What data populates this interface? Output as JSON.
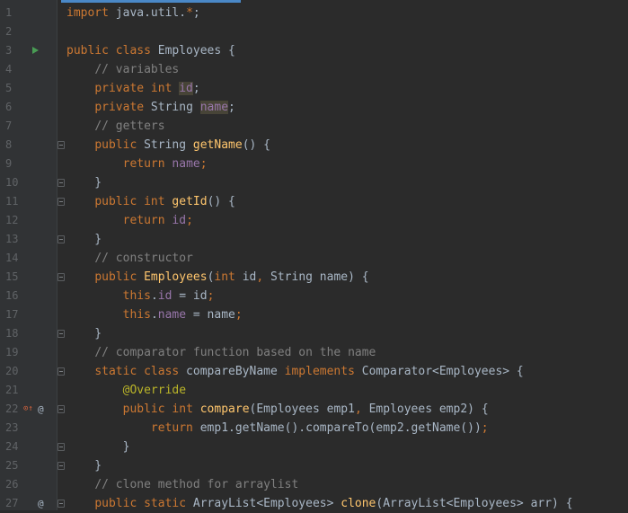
{
  "colors": {
    "background": "#2b2b2b",
    "gutter": "#313335",
    "keyword": "#cc7832",
    "comment": "#808080",
    "method": "#ffc66d",
    "field": "#9876aa",
    "annotation": "#bbb529",
    "text": "#a9b7c6",
    "line_number": "#606366",
    "run_icon": "#499c54"
  },
  "lines": [
    {
      "n": "1",
      "tokens": [
        [
          "kw",
          "import"
        ],
        [
          "t",
          " java.util."
        ],
        [
          "kw",
          "*"
        ],
        [
          "t",
          ";"
        ]
      ]
    },
    {
      "n": "2",
      "tokens": []
    },
    {
      "n": "3",
      "run": true,
      "tokens": [
        [
          "kw",
          "public class"
        ],
        [
          "t",
          " Employees {"
        ]
      ]
    },
    {
      "n": "4",
      "tokens": [
        [
          "t",
          "    "
        ],
        [
          "cm",
          "// variables"
        ]
      ]
    },
    {
      "n": "5",
      "tokens": [
        [
          "t",
          "    "
        ],
        [
          "kw",
          "private int"
        ],
        [
          "t",
          " "
        ],
        [
          "fldhl",
          "id"
        ],
        [
          "t",
          ";"
        ]
      ]
    },
    {
      "n": "6",
      "tokens": [
        [
          "t",
          "    "
        ],
        [
          "kw",
          "private"
        ],
        [
          "t",
          " String "
        ],
        [
          "fldhl",
          "name"
        ],
        [
          "t",
          ";"
        ]
      ]
    },
    {
      "n": "7",
      "tokens": [
        [
          "t",
          "    "
        ],
        [
          "cm",
          "// getters"
        ]
      ]
    },
    {
      "n": "8",
      "fold": "start",
      "tokens": [
        [
          "t",
          "    "
        ],
        [
          "kw",
          "public"
        ],
        [
          "t",
          " String "
        ],
        [
          "fn",
          "getName"
        ],
        [
          "t",
          "() {"
        ]
      ]
    },
    {
      "n": "9",
      "tokens": [
        [
          "t",
          "        "
        ],
        [
          "kw",
          "return"
        ],
        [
          "t",
          " "
        ],
        [
          "fld",
          "name"
        ],
        [
          "kw",
          ";"
        ]
      ]
    },
    {
      "n": "10",
      "fold": "end",
      "tokens": [
        [
          "t",
          "    }"
        ]
      ]
    },
    {
      "n": "11",
      "fold": "start",
      "tokens": [
        [
          "t",
          "    "
        ],
        [
          "kw",
          "public int"
        ],
        [
          "t",
          " "
        ],
        [
          "fn",
          "getId"
        ],
        [
          "t",
          "() {"
        ]
      ]
    },
    {
      "n": "12",
      "tokens": [
        [
          "t",
          "        "
        ],
        [
          "kw",
          "return"
        ],
        [
          "t",
          " "
        ],
        [
          "fld",
          "id"
        ],
        [
          "kw",
          ";"
        ]
      ]
    },
    {
      "n": "13",
      "fold": "end",
      "tokens": [
        [
          "t",
          "    }"
        ]
      ]
    },
    {
      "n": "14",
      "tokens": [
        [
          "t",
          "    "
        ],
        [
          "cm",
          "// constructor"
        ]
      ]
    },
    {
      "n": "15",
      "fold": "start",
      "tokens": [
        [
          "t",
          "    "
        ],
        [
          "kw",
          "public"
        ],
        [
          "t",
          " "
        ],
        [
          "fn",
          "Employees"
        ],
        [
          "t",
          "("
        ],
        [
          "kw",
          "int"
        ],
        [
          "t",
          " id"
        ],
        [
          "kw",
          ","
        ],
        [
          "t",
          " String name) {"
        ]
      ]
    },
    {
      "n": "16",
      "tokens": [
        [
          "t",
          "        "
        ],
        [
          "kw",
          "this"
        ],
        [
          "t",
          "."
        ],
        [
          "fld",
          "id"
        ],
        [
          "t",
          " = id"
        ],
        [
          "kw",
          ";"
        ]
      ]
    },
    {
      "n": "17",
      "tokens": [
        [
          "t",
          "        "
        ],
        [
          "kw",
          "this"
        ],
        [
          "t",
          "."
        ],
        [
          "fld",
          "name"
        ],
        [
          "t",
          " = name"
        ],
        [
          "kw",
          ";"
        ]
      ]
    },
    {
      "n": "18",
      "fold": "end",
      "tokens": [
        [
          "t",
          "    }"
        ]
      ]
    },
    {
      "n": "19",
      "tokens": [
        [
          "t",
          "    "
        ],
        [
          "cm",
          "// comparator function based on the name"
        ]
      ]
    },
    {
      "n": "20",
      "fold": "start",
      "tokens": [
        [
          "t",
          "    "
        ],
        [
          "kw",
          "static class"
        ],
        [
          "t",
          " compareByName "
        ],
        [
          "kw",
          "implements"
        ],
        [
          "t",
          " Comparator<Employees> {"
        ]
      ]
    },
    {
      "n": "21",
      "tokens": [
        [
          "t",
          "        "
        ],
        [
          "ann",
          "@Override"
        ]
      ]
    },
    {
      "n": "22",
      "override": true,
      "fold": "start",
      "tokens": [
        [
          "t",
          "        "
        ],
        [
          "kw",
          "public int"
        ],
        [
          "t",
          " "
        ],
        [
          "fn",
          "compare"
        ],
        [
          "t",
          "(Employees emp1"
        ],
        [
          "kw",
          ","
        ],
        [
          "t",
          " Employees emp2) {"
        ]
      ]
    },
    {
      "n": "23",
      "tokens": [
        [
          "t",
          "            "
        ],
        [
          "kw",
          "return"
        ],
        [
          "t",
          " emp1.getName().compareTo(emp2.getName())"
        ],
        [
          "kw",
          ";"
        ]
      ]
    },
    {
      "n": "24",
      "fold": "end",
      "tokens": [
        [
          "t",
          "        }"
        ]
      ]
    },
    {
      "n": "25",
      "fold": "end",
      "tokens": [
        [
          "t",
          "    }"
        ]
      ]
    },
    {
      "n": "26",
      "tokens": [
        [
          "t",
          "    "
        ],
        [
          "cm",
          "// clone method for arraylist"
        ]
      ]
    },
    {
      "n": "27",
      "at": true,
      "fold": "start",
      "tokens": [
        [
          "t",
          "    "
        ],
        [
          "kw",
          "public static"
        ],
        [
          "t",
          " ArrayList<Employees> "
        ],
        [
          "fn",
          "clone"
        ],
        [
          "t",
          "(ArrayList<Employees> arr) {"
        ]
      ]
    }
  ]
}
